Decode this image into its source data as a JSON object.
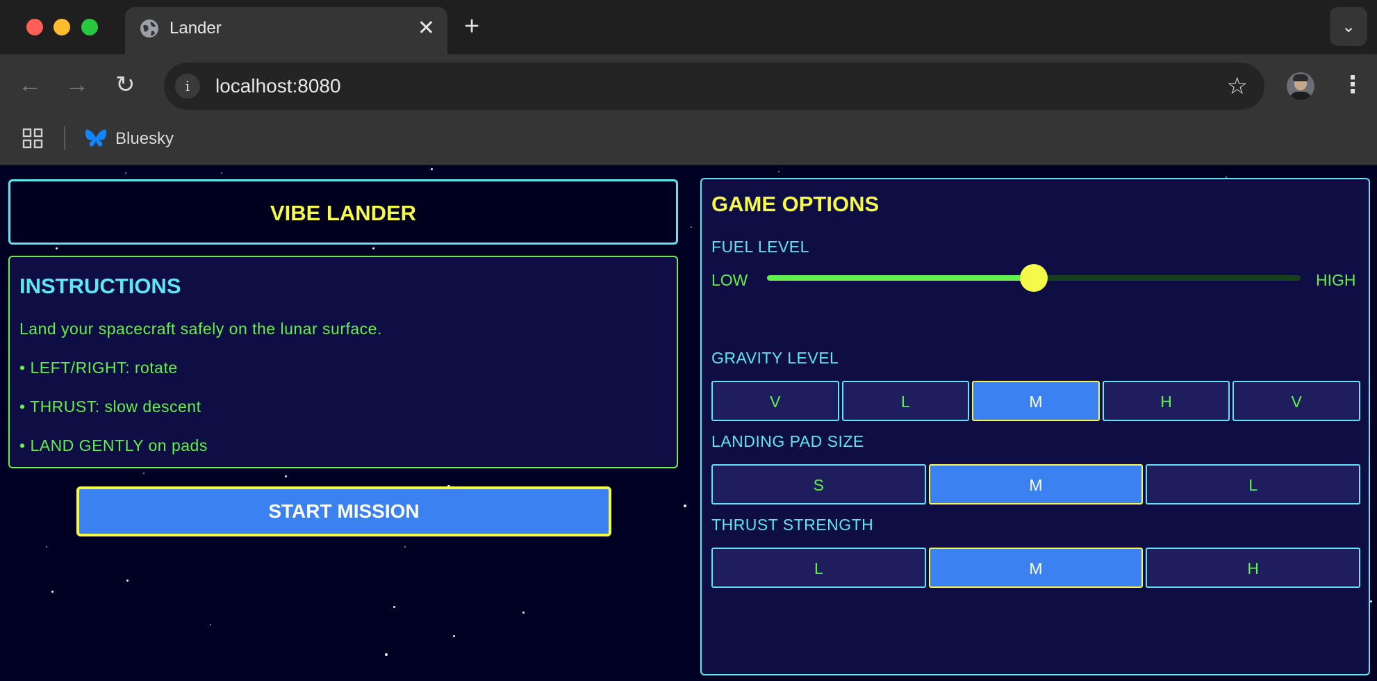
{
  "browser": {
    "tab_title": "Lander",
    "tab_close_glyph": "✕",
    "new_tab_glyph": "+",
    "tab_search_glyph": "⌄",
    "url": "localhost:8080",
    "info_glyph": "i",
    "star_glyph": "☆",
    "menu_glyph": "⋮",
    "back_glyph": "←",
    "forward_glyph": "→",
    "reload_glyph": "↻",
    "bookmarks": [
      {
        "label": "Bluesky",
        "icon": "butterfly-icon"
      }
    ]
  },
  "game": {
    "title": "VIBE LANDER",
    "instructions": {
      "heading": "INSTRUCTIONS",
      "lines": [
        "Land your spacecraft safely on the lunar surface.",
        "• LEFT/RIGHT: rotate",
        "• THRUST: slow descent",
        "• LAND GENTLY on pads"
      ]
    },
    "start_label": "START MISSION"
  },
  "options": {
    "heading": "GAME OPTIONS",
    "fuel": {
      "label": "FUEL LEVEL",
      "low_label": "LOW",
      "high_label": "HIGH",
      "value_fraction": 0.5
    },
    "gravity": {
      "label": "GRAVITY LEVEL",
      "choices": [
        "V",
        "L",
        "M",
        "H",
        "V"
      ],
      "selected_index": 2
    },
    "pad_size": {
      "label": "LANDING PAD SIZE",
      "choices": [
        "S",
        "M",
        "L"
      ],
      "selected_index": 1
    },
    "thrust": {
      "label": "THRUST STRENGTH",
      "choices": [
        "L",
        "M",
        "H"
      ],
      "selected_index": 1
    }
  },
  "colors": {
    "accent_cyan": "#5ee7f2",
    "accent_yellow": "#f4f94a",
    "accent_green": "#63f04a",
    "button_blue": "#3b82f0",
    "space_bg": "#000022"
  }
}
